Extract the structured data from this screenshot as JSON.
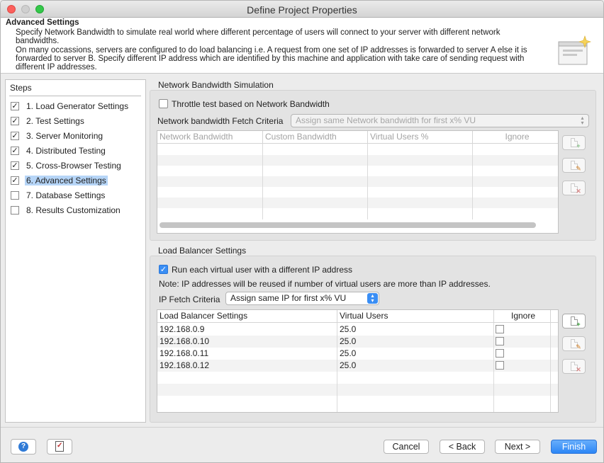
{
  "window": {
    "title": "Define Project Properties"
  },
  "header": {
    "title": "Advanced Settings",
    "description": [
      "Specify Network Bandwidth to simulate real world where different percentage of users will connect to your server with different network bandwidths.",
      "On many occassions, servers are configured to do load balancing i.e. A request from one set of IP addresses is forwarded to server A else it is forwarded to server B. Specify different IP address which are identified by this machine and application with take care of sending request with different IP addresses."
    ]
  },
  "steps": {
    "title": "Steps",
    "items": [
      {
        "label": "1. Load Generator Settings",
        "checked": true
      },
      {
        "label": "2. Test Settings",
        "checked": true
      },
      {
        "label": "3. Server Monitoring",
        "checked": true
      },
      {
        "label": "4. Distributed Testing",
        "checked": true
      },
      {
        "label": "5. Cross-Browser Testing",
        "checked": true
      },
      {
        "label": "6. Advanced Settings",
        "checked": true,
        "active": true
      },
      {
        "label": "7. Database Settings",
        "checked": false
      },
      {
        "label": "8. Results Customization",
        "checked": false
      }
    ]
  },
  "network": {
    "group_title": "Network Bandwidth Simulation",
    "throttle_label": "Throttle test based on Network Bandwidth",
    "throttle_checked": false,
    "fetch_label": "Network bandwidth Fetch Criteria",
    "fetch_value": "Assign same Network bandwidth for first x% VU",
    "columns": [
      "Network Bandwidth",
      "Custom Bandwidth",
      "Virtual Users %",
      "Ignore"
    ]
  },
  "loadbalancer": {
    "group_title": "Load Balancer Settings",
    "run_label": "Run each virtual user with a different IP address",
    "run_checked": true,
    "note": "Note: IP addresses will be reused if number of virtual users are more than IP addresses.",
    "fetch_label": "IP Fetch Criteria",
    "fetch_value": "Assign same IP for first x% VU",
    "columns": [
      "Load Balancer Settings",
      "Virtual Users",
      "Ignore"
    ],
    "rows": [
      {
        "ip": "192.168.0.9",
        "vu": "25.0",
        "ignore": false
      },
      {
        "ip": "192.168.0.10",
        "vu": "25.0",
        "ignore": false
      },
      {
        "ip": "192.168.0.11",
        "vu": "25.0",
        "ignore": false
      },
      {
        "ip": "192.168.0.12",
        "vu": "25.0",
        "ignore": false
      }
    ]
  },
  "buttons": {
    "cancel": "Cancel",
    "back": "< Back",
    "next": "Next >",
    "finish": "Finish"
  },
  "icons": {
    "help": "help-icon",
    "report": "checklist-icon",
    "add": "add-row-icon",
    "edit": "edit-row-icon",
    "delete": "delete-row-icon"
  },
  "colors": {
    "accent": "#3a8ef4",
    "selection": "#b6d5f7"
  }
}
